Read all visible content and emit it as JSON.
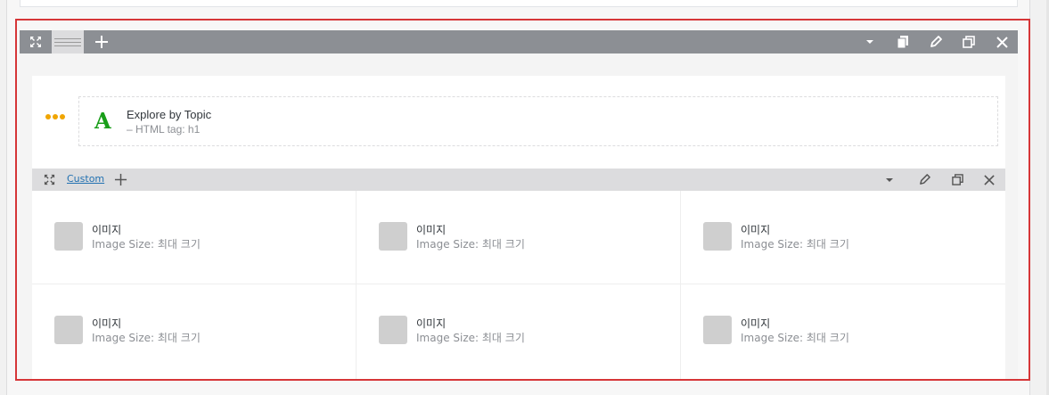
{
  "row": {
    "toolbar": {
      "icons": [
        "expand-icon",
        "drag-handle-icon",
        "plus-icon",
        "caret-down-icon",
        "copy-icon",
        "pencil-icon",
        "duplicate-icon",
        "close-icon"
      ],
      "bar_color": "#8c8f94"
    },
    "title_module": {
      "title": "Explore by Topic",
      "subtitle": "– HTML tag: h1",
      "letter": "A",
      "letter_color": "#1a9e1a",
      "dots_color": "#f0a500"
    },
    "inner_row": {
      "label": "Custom",
      "icons": [
        "expand-icon",
        "plus-icon",
        "caret-down-icon",
        "pencil-icon",
        "duplicate-icon",
        "close-icon"
      ]
    },
    "image_modules": [
      {
        "title": "이미지",
        "subtitle": "Image Size: 최대 크기"
      },
      {
        "title": "이미지",
        "subtitle": "Image Size: 최대 크기"
      },
      {
        "title": "이미지",
        "subtitle": "Image Size: 최대 크기"
      },
      {
        "title": "이미지",
        "subtitle": "Image Size: 최대 크기"
      },
      {
        "title": "이미지",
        "subtitle": "Image Size: 최대 크기"
      },
      {
        "title": "이미지",
        "subtitle": "Image Size: 최대 크기"
      }
    ]
  },
  "selection_color": "#d63638"
}
